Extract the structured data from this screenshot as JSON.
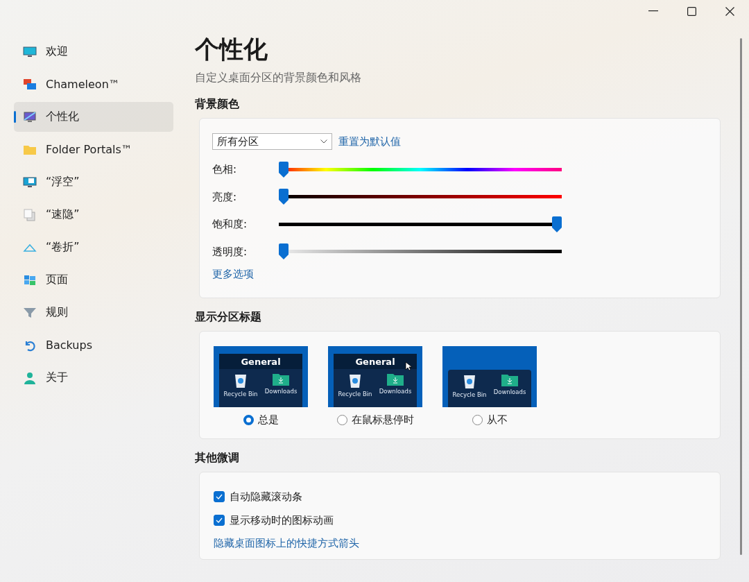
{
  "sidebar": {
    "items": [
      {
        "label": "欢迎",
        "selected": false
      },
      {
        "label": "Chameleon™",
        "selected": false
      },
      {
        "label": "个性化",
        "selected": true
      },
      {
        "label": "Folder Portals™",
        "selected": false
      },
      {
        "label": "“浮空”",
        "selected": false
      },
      {
        "label": "“速隐”",
        "selected": false
      },
      {
        "label": "“卷折”",
        "selected": false
      },
      {
        "label": "页面",
        "selected": false
      },
      {
        "label": "规则",
        "selected": false
      },
      {
        "label": "Backups",
        "selected": false
      },
      {
        "label": "关于",
        "selected": false
      }
    ]
  },
  "page": {
    "title": "个性化",
    "subtitle": "自定义桌面分区的背景颜色和风格"
  },
  "background_color": {
    "heading": "背景颜色",
    "dropdown": "所有分区",
    "reset_link": "重置为默认值",
    "sliders": [
      {
        "label": "色相:",
        "kind": "hue",
        "level": 0
      },
      {
        "label": "亮度:",
        "kind": "brightness",
        "level": 0
      },
      {
        "label": "饱和度:",
        "kind": "saturation",
        "level": 1
      },
      {
        "label": "透明度:",
        "kind": "transparency",
        "level": 0
      }
    ],
    "more_link": "更多选项"
  },
  "show_titles": {
    "heading": "显示分区标题",
    "options": [
      {
        "label": "总是",
        "selected": true,
        "header": "General",
        "cursor": false,
        "items": [
          "Recycle Bin",
          "Downloads"
        ]
      },
      {
        "label": "在鼠标悬停时",
        "selected": false,
        "header": "General",
        "cursor": true,
        "items": [
          "Recycle Bin",
          "Downloads"
        ]
      },
      {
        "label": "从不",
        "selected": false,
        "cursor": false,
        "items": [
          "Recycle Bin",
          "Downloads"
        ]
      }
    ]
  },
  "tweaks": {
    "heading": "其他微调",
    "checkboxes": [
      {
        "label": "自动隐藏滚动条",
        "checked": true
      },
      {
        "label": "显示移动时的图标动画",
        "checked": true
      }
    ],
    "link": "隐藏桌面图标上的快捷方式箭头"
  }
}
